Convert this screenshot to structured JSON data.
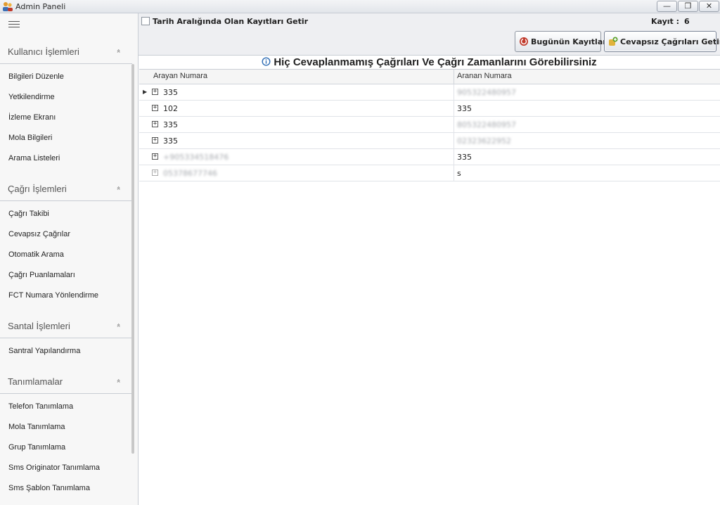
{
  "window": {
    "title": "Admin Paneli",
    "min_glyph": "—",
    "max_glyph": "❐",
    "close_glyph": "✕"
  },
  "sidebar": {
    "menu_icon": "hamburger-icon",
    "sections": [
      {
        "title": "Kullanıcı İşlemleri",
        "items": [
          "Bilgileri Düzenle",
          "Yetkilendirme",
          "İzleme Ekranı",
          "Mola Bilgileri",
          "Arama Listeleri"
        ]
      },
      {
        "title": "Çağrı İşlemleri",
        "items": [
          "Çağrı Takibi",
          "Cevapsız Çağrılar",
          "Otomatik Arama",
          "Çağrı Puanlamaları",
          "FCT Numara Yönlendirme"
        ]
      },
      {
        "title": "Santal İşlemleri",
        "items": [
          "Santral Yapılandırma"
        ]
      },
      {
        "title": "Tanımlamalar",
        "items": [
          "Telefon Tanımlama",
          "Mola Tanımlama",
          "Grup Tanımlama",
          "Sms Originator Tanımlama",
          "Sms Şablon Tanımlama"
        ]
      }
    ],
    "chevron": "»"
  },
  "toolbar": {
    "date_range_label": "Tarih Aralığında Olan Kayıtları Getir",
    "record_label": "Kayıt :",
    "record_count": "6",
    "today_button": "Bugünün Kayıtları",
    "missed_button": "Cevapsız Çağrıları Getir"
  },
  "heading": "Hiç Cevaplanmamış Çağrıları Ve Çağrı Zamanlarını Görebilirsiniz",
  "grid": {
    "columns": [
      "Arayan Numara",
      "Aranan Numara"
    ],
    "rows": [
      {
        "caller": "335",
        "callee": "905322480957",
        "callee_blurred": true
      },
      {
        "caller": "102",
        "callee": "335"
      },
      {
        "caller": "335",
        "callee": "805322480957",
        "callee_blurred": true
      },
      {
        "caller": "335",
        "callee": "02323622952",
        "callee_blurred": true
      },
      {
        "caller": "+905334518476",
        "caller_blurred": true,
        "callee": "335"
      },
      {
        "caller": "05378677746",
        "caller_blurred": true,
        "callee": "s"
      }
    ]
  },
  "colors": {
    "accent_red": "#c0392b",
    "accent_green": "#5aa02c",
    "info_blue": "#2f6db5"
  }
}
